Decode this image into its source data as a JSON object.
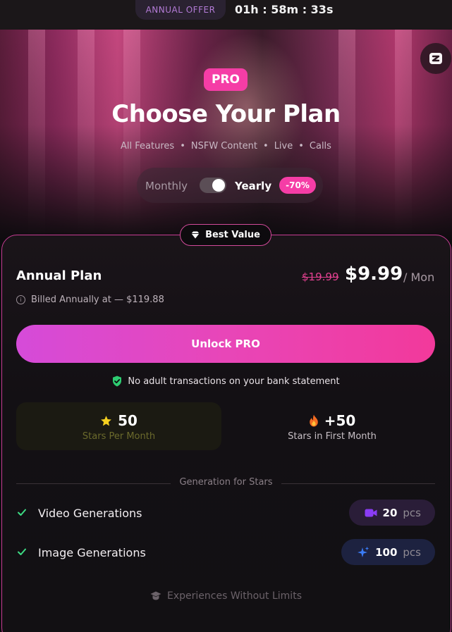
{
  "topbar": {
    "offer_label": "ANNUAL OFFER",
    "timer": "01h : 58m : 33s"
  },
  "hero": {
    "badge": "PRO",
    "title": "Choose Your Plan",
    "features": [
      "All Features",
      "NSFW Content",
      "Live",
      "Calls"
    ],
    "separator": "•",
    "toggle": {
      "monthly_label": "Monthly",
      "yearly_label": "Yearly",
      "selected": "Yearly",
      "discount": "-70%"
    }
  },
  "plan": {
    "badge": "Best Value",
    "name": "Annual Plan",
    "old_price": "$19.99",
    "price": "$9.99",
    "period": "/ Mon",
    "billed_note": "Billed Annually at — $119.88",
    "cta": "Unlock PRO",
    "privacy_note": "No adult transactions on your bank statement",
    "stars": {
      "value": "50",
      "label": "Stars Per Month"
    },
    "bonus": {
      "value": "+50",
      "label": "Stars in First Month"
    },
    "generation_title": "Generation for Stars",
    "generations": [
      {
        "label": "Video Generations",
        "amount": "20",
        "unit": "pcs",
        "icon": "video-camera-icon",
        "color": "#7b2ff0"
      },
      {
        "label": "Image Generations",
        "amount": "100",
        "unit": "pcs",
        "icon": "sparkle-icon",
        "color": "#3b6cf5"
      }
    ],
    "footer": "Experiences Without Limits"
  },
  "colors": {
    "accent_pink": "#f53da6",
    "check_green": "#3ddc84",
    "shield_green": "#2ecc71",
    "star_yellow": "#f5d020"
  }
}
